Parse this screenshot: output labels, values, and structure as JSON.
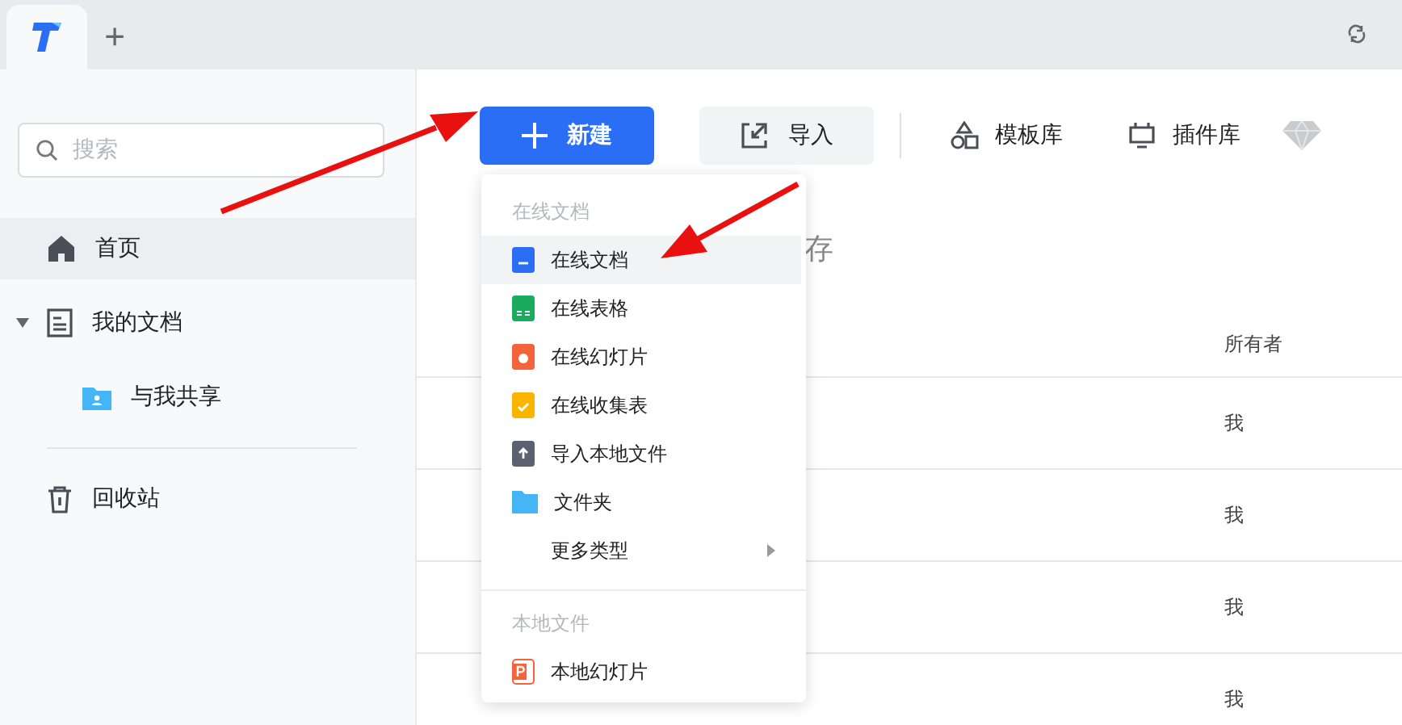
{
  "tabbar": {
    "tabs": [
      {
        "kind": "logo",
        "selected": true
      }
    ],
    "new_tab": "+"
  },
  "sidebar": {
    "search": {
      "placeholder": "搜索"
    },
    "items": [
      {
        "label": "首页",
        "kind": "home",
        "selected": true
      },
      {
        "label": "我的文档",
        "kind": "doc",
        "selected": false,
        "expanded": true,
        "children": [
          {
            "label": "与我共享",
            "kind": "shared",
            "selected": false
          }
        ]
      }
    ],
    "footer_items": [
      {
        "label": "回收站",
        "kind": "trash",
        "selected": false
      }
    ]
  },
  "toolbar": {
    "new_button": "新建",
    "import_button": "导入",
    "links": [
      {
        "label": "模板库"
      },
      {
        "label": "插件库"
      }
    ]
  },
  "content": {
    "heading": "存",
    "columns": [
      {
        "label": "所有者"
      }
    ],
    "rows": [
      {
        "owner": "我"
      },
      {
        "owner": "我"
      },
      {
        "owner": "我"
      },
      {
        "owner": "我"
      }
    ]
  },
  "new_menu": {
    "sections": [
      {
        "header": "在线文档",
        "items": [
          {
            "label": "在线文档",
            "kind": "doc",
            "selected": true
          },
          {
            "label": "在线表格",
            "kind": "sheet",
            "selected": false
          },
          {
            "label": "在线幻灯片",
            "kind": "slides",
            "selected": false
          },
          {
            "label": "在线收集表",
            "kind": "form",
            "selected": false
          },
          {
            "label": "导入本地文件",
            "kind": "import",
            "selected": false
          },
          {
            "label": "文件夹",
            "kind": "folder",
            "selected": false
          },
          {
            "label": "更多类型",
            "kind": "more",
            "selected": false
          }
        ]
      },
      {
        "header": "本地文件",
        "items": [
          {
            "label": "本地幻灯片",
            "kind": "local_slides",
            "selected": false
          }
        ]
      }
    ]
  }
}
